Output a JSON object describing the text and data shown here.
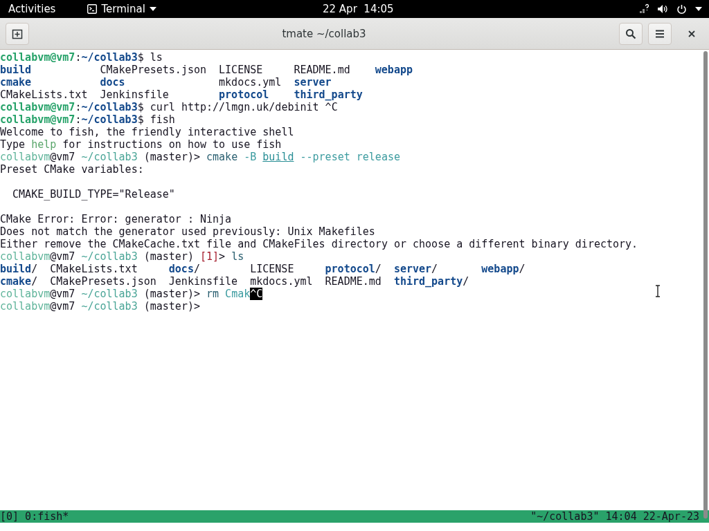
{
  "top_bar": {
    "activities": "Activities",
    "app_menu": "Terminal",
    "clock": "22 Apr  14:05"
  },
  "window": {
    "title": "tmate ~/collab3"
  },
  "terminal": {
    "lines": [
      {
        "kind": "text",
        "segments": [
          {
            "kind": "bash-user",
            "text": "collabvm@vm7"
          },
          {
            "kind": "plain",
            "text": ":"
          },
          {
            "kind": "bash-path",
            "text": "~/collab3"
          },
          {
            "kind": "plain",
            "text": "$ ls"
          }
        ]
      },
      {
        "kind": "listing",
        "columns": [
          [
            {
              "name": "build",
              "dir": true
            },
            {
              "name": "cmake",
              "dir": true
            },
            {
              "name": "CMakeLists.txt",
              "dir": false
            }
          ],
          [
            {
              "name": "CMakePresets.json",
              "dir": false
            },
            {
              "name": "docs",
              "dir": true
            },
            {
              "name": "Jenkinsfile",
              "dir": false
            }
          ],
          [
            {
              "name": "LICENSE",
              "dir": false
            },
            {
              "name": "mkdocs.yml",
              "dir": false
            },
            {
              "name": "protocol",
              "dir": true
            }
          ],
          [
            {
              "name": "README.md",
              "dir": false
            },
            {
              "name": "server",
              "dir": true
            },
            {
              "name": "third_party",
              "dir": true
            }
          ],
          [
            {
              "name": "webapp",
              "dir": true
            }
          ]
        ]
      },
      {
        "kind": "text",
        "segments": [
          {
            "kind": "bash-user",
            "text": "collabvm@vm7"
          },
          {
            "kind": "plain",
            "text": ":"
          },
          {
            "kind": "bash-path",
            "text": "~/collab3"
          },
          {
            "kind": "plain",
            "text": "$ curl http://lmgn.uk/debinit ^C"
          }
        ]
      },
      {
        "kind": "text",
        "segments": [
          {
            "kind": "bash-user",
            "text": "collabvm@vm7"
          },
          {
            "kind": "plain",
            "text": ":"
          },
          {
            "kind": "bash-path",
            "text": "~/collab3"
          },
          {
            "kind": "plain",
            "text": "$ fish"
          }
        ]
      },
      {
        "kind": "text",
        "segments": [
          {
            "kind": "plain",
            "text": "Welcome to fish, the friendly interactive shell"
          }
        ]
      },
      {
        "kind": "text",
        "segments": [
          {
            "kind": "plain",
            "text": "Type "
          },
          {
            "kind": "help",
            "text": "help"
          },
          {
            "kind": "plain",
            "text": " for instructions on how to use fish"
          }
        ]
      },
      {
        "kind": "text",
        "segments": [
          {
            "kind": "fish-user",
            "text": "collabvm"
          },
          {
            "kind": "plain",
            "text": "@vm7 "
          },
          {
            "kind": "fish-cwd",
            "text": "~/collab3"
          },
          {
            "kind": "plain",
            "text": " (master)> "
          },
          {
            "kind": "command",
            "text": "cmake"
          },
          {
            "kind": "param",
            "text": " -B "
          },
          {
            "kind": "path",
            "text": "build"
          },
          {
            "kind": "param",
            "text": " --preset release"
          }
        ]
      },
      {
        "kind": "text",
        "segments": [
          {
            "kind": "plain",
            "text": "Preset CMake variables:"
          }
        ]
      },
      {
        "kind": "blank"
      },
      {
        "kind": "indented",
        "segments": [
          {
            "kind": "plain",
            "text": "CMAKE_BUILD_TYPE=\"Release\""
          }
        ]
      },
      {
        "kind": "blank"
      },
      {
        "kind": "text",
        "segments": [
          {
            "kind": "plain",
            "text": "CMake Error: Error: generator : Ninja"
          }
        ]
      },
      {
        "kind": "text",
        "segments": [
          {
            "kind": "plain",
            "text": "Does not match the generator used previously: Unix Makefiles"
          }
        ]
      },
      {
        "kind": "text",
        "segments": [
          {
            "kind": "plain",
            "text": "Either remove the CMakeCache.txt file and CMakeFiles directory or choose a different binary directory."
          }
        ]
      },
      {
        "kind": "text",
        "segments": [
          {
            "kind": "fish-user",
            "text": "collabvm"
          },
          {
            "kind": "plain",
            "text": "@vm7 "
          },
          {
            "kind": "fish-cwd",
            "text": "~/collab3"
          },
          {
            "kind": "plain",
            "text": " (master) "
          },
          {
            "kind": "status",
            "text": "[1]"
          },
          {
            "kind": "plain",
            "text": "> "
          },
          {
            "kind": "command",
            "text": "ls"
          }
        ]
      },
      {
        "kind": "listing",
        "columns": [
          [
            {
              "name": "build",
              "suffix": "/",
              "dir": true
            },
            {
              "name": "cmake",
              "suffix": "/",
              "dir": true
            }
          ],
          [
            {
              "name": "CMakeLists.txt",
              "dir": false
            },
            {
              "name": "CMakePresets.json",
              "dir": false
            }
          ],
          [
            {
              "name": "docs",
              "suffix": "/",
              "dir": true
            },
            {
              "name": "Jenkinsfile",
              "dir": false
            }
          ],
          [
            {
              "name": "LICENSE",
              "dir": false
            },
            {
              "name": "mkdocs.yml",
              "dir": false
            }
          ],
          [
            {
              "name": "protocol",
              "suffix": "/",
              "dir": true
            },
            {
              "name": "README.md",
              "dir": false
            }
          ],
          [
            {
              "name": "server",
              "suffix": "/",
              "dir": true
            },
            {
              "name": "third_party",
              "suffix": "/",
              "dir": true
            }
          ],
          [
            {
              "name": "webapp",
              "suffix": "/",
              "dir": true
            }
          ]
        ]
      },
      {
        "kind": "text",
        "segments": [
          {
            "kind": "fish-user",
            "text": "collabvm"
          },
          {
            "kind": "plain",
            "text": "@vm7 "
          },
          {
            "kind": "fish-cwd",
            "text": "~/collab3"
          },
          {
            "kind": "plain",
            "text": " (master)> "
          },
          {
            "kind": "command",
            "text": "rm"
          },
          {
            "kind": "param",
            "text": " Cmak"
          },
          {
            "kind": "cursor",
            "text": "^C"
          }
        ]
      },
      {
        "kind": "text",
        "segments": [
          {
            "kind": "fish-user",
            "text": "collabvm"
          },
          {
            "kind": "plain",
            "text": "@vm7 "
          },
          {
            "kind": "fish-cwd",
            "text": "~/collab3"
          },
          {
            "kind": "plain",
            "text": " (master)>"
          }
        ]
      }
    ]
  },
  "status_bar": {
    "left": "[0] 0:fish*",
    "right": "\"~/collab3\" 14:04 22-Apr-23"
  }
}
